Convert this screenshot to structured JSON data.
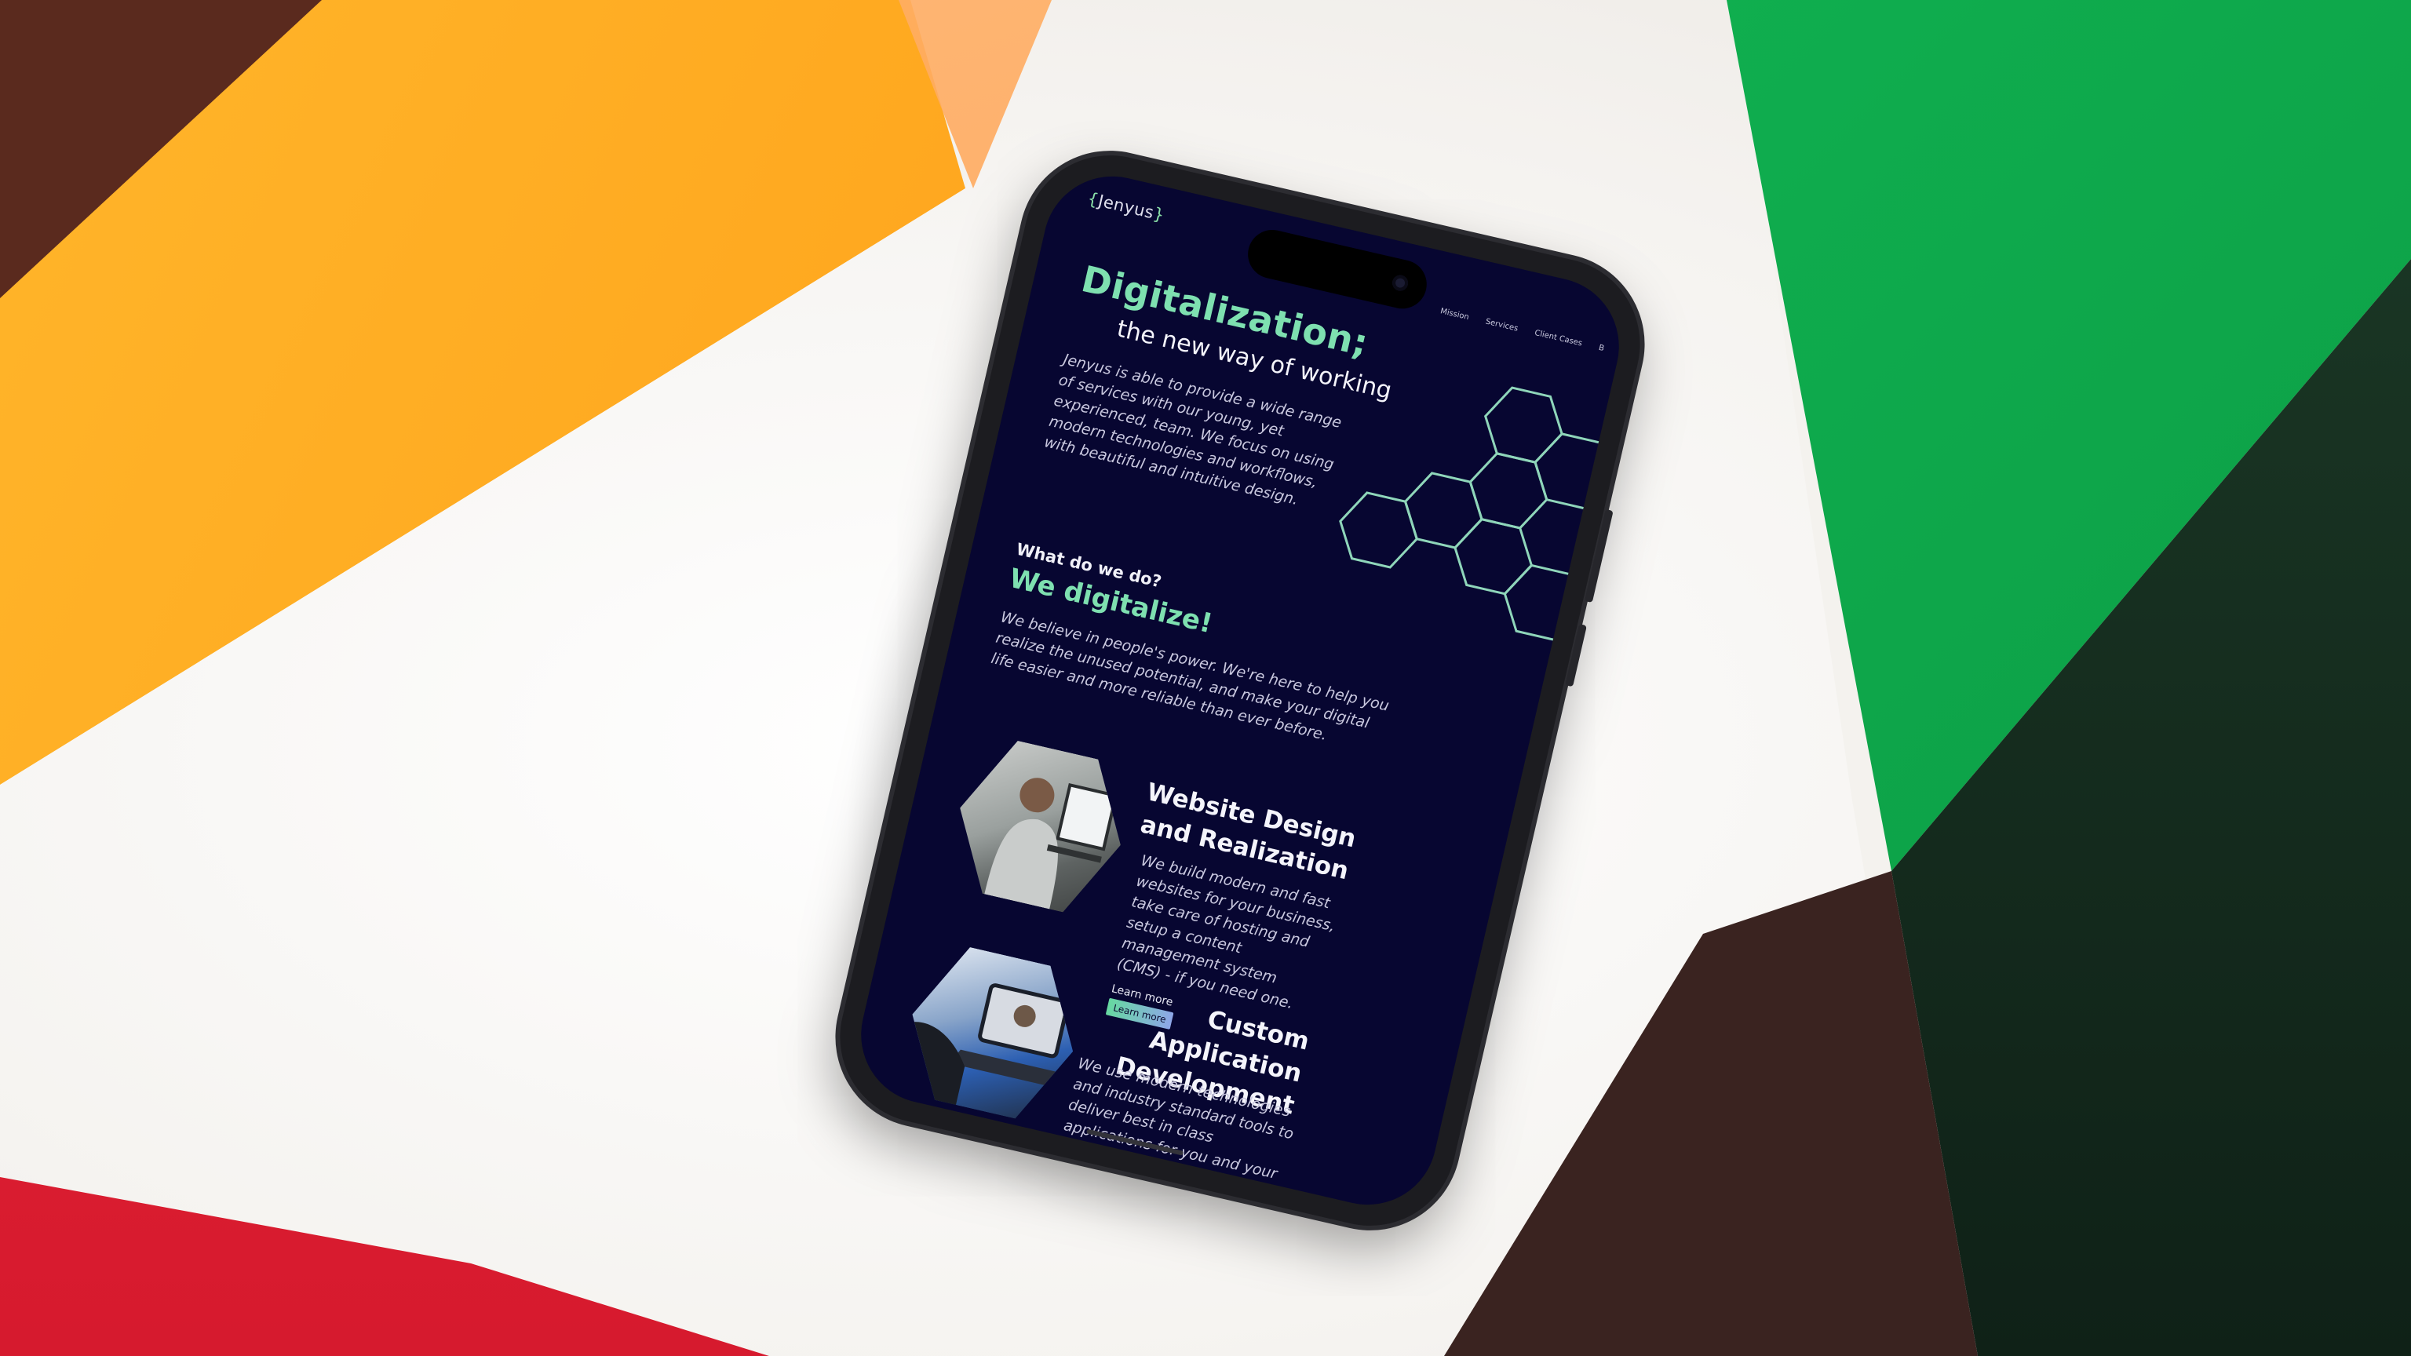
{
  "colors": {
    "screen_bg": "#070631",
    "accent_green": "#7ee0b0",
    "hex_stroke": "#8fd6ba",
    "button_gradient_start": "#66d9a0",
    "button_gradient_end": "#8ea6e8"
  },
  "header": {
    "logo": {
      "open": "{",
      "name": "Jenyus",
      "close": "}"
    },
    "nav": [
      "Mission",
      "Services",
      "Client Cases",
      "B"
    ]
  },
  "hero": {
    "title": "Digitalization;",
    "subtitle": "the new way of working",
    "body": "Jenyus is able to provide a wide range of services with our young, yet experienced, team. We focus on using modern technologies and workflows, with beautiful and intuitive design."
  },
  "about": {
    "question": "What do we do?",
    "headline": "We digitalize!",
    "body": "We believe in people's power. We're here to help you realize the unused potential, and make your digital life easier and more reliable than ever before."
  },
  "services": [
    {
      "title_line1": "Website Design",
      "title_line2": "and Realization",
      "body": "We build modern and fast websites for your business, take care of hosting and setup a content management system (CMS) - if you need one.",
      "learn_more_text": "Learn more",
      "learn_more_button": "Learn more"
    },
    {
      "title_line1": "Custom Application",
      "title_line2": "Development",
      "body": "We use modern technologies and industry standard tools to deliver best in class applications for you and your users. Be it an app, a website or an internal tool"
    }
  ]
}
